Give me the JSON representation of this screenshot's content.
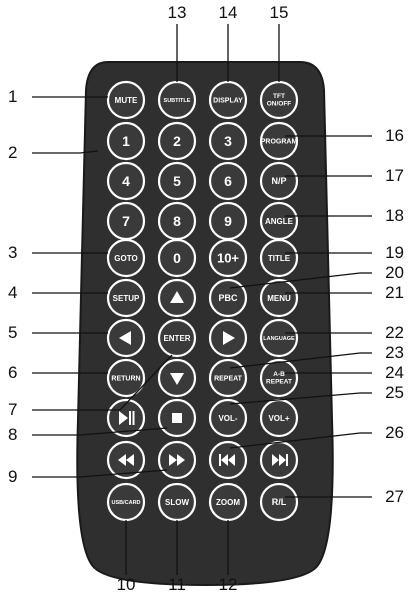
{
  "buttons": [
    {
      "id": "mute",
      "label": "MUTE"
    },
    {
      "id": "subtitle",
      "label": "SUBTITLE"
    },
    {
      "id": "display",
      "label": "DISPLAY"
    },
    {
      "id": "tft",
      "label": "TFT ON/OFF"
    },
    {
      "id": "num-1",
      "label": "1"
    },
    {
      "id": "num-2",
      "label": "2"
    },
    {
      "id": "num-3",
      "label": "3"
    },
    {
      "id": "program",
      "label": "PROGRAM"
    },
    {
      "id": "num-4",
      "label": "4"
    },
    {
      "id": "num-5",
      "label": "5"
    },
    {
      "id": "num-6",
      "label": "6"
    },
    {
      "id": "np",
      "label": "N/P"
    },
    {
      "id": "num-7",
      "label": "7"
    },
    {
      "id": "num-8",
      "label": "8"
    },
    {
      "id": "num-9",
      "label": "9"
    },
    {
      "id": "angle",
      "label": "ANGLE"
    },
    {
      "id": "goto",
      "label": "GOTO"
    },
    {
      "id": "num-0",
      "label": "0"
    },
    {
      "id": "num-10plus",
      "label": "10+"
    },
    {
      "id": "title",
      "label": "TITLE"
    },
    {
      "id": "setup",
      "label": "SETUP"
    },
    {
      "id": "up",
      "label": "",
      "icon": "up-arrow-icon"
    },
    {
      "id": "pbc",
      "label": "PBC"
    },
    {
      "id": "menu",
      "label": "MENU"
    },
    {
      "id": "left",
      "label": "",
      "icon": "left-arrow-icon"
    },
    {
      "id": "enter",
      "label": "ENTER"
    },
    {
      "id": "right",
      "label": "",
      "icon": "right-arrow-icon"
    },
    {
      "id": "language",
      "label": "LANGUAGE"
    },
    {
      "id": "return",
      "label": "RETURN"
    },
    {
      "id": "down",
      "label": "",
      "icon": "down-arrow-icon"
    },
    {
      "id": "repeat",
      "label": "REPEAT"
    },
    {
      "id": "ab-repeat",
      "label": "A-B REPEAT"
    },
    {
      "id": "play-pause",
      "label": "",
      "icon": "play-pause-icon"
    },
    {
      "id": "stop",
      "label": "",
      "icon": "stop-icon"
    },
    {
      "id": "vol-down",
      "label": "VOL-"
    },
    {
      "id": "vol-up",
      "label": "VOL+"
    },
    {
      "id": "rewind",
      "label": "",
      "icon": "rewind-icon"
    },
    {
      "id": "fast-forward",
      "label": "",
      "icon": "fast-forward-icon"
    },
    {
      "id": "prev",
      "label": "",
      "icon": "previous-track-icon"
    },
    {
      "id": "next",
      "label": "",
      "icon": "next-track-icon"
    },
    {
      "id": "usb-card",
      "label": "USB/CARD"
    },
    {
      "id": "slow",
      "label": "SLOW"
    },
    {
      "id": "zoom",
      "label": "ZOOM"
    },
    {
      "id": "rl",
      "label": "R/L"
    }
  ],
  "callouts": [
    {
      "number": "1",
      "target": "mute"
    },
    {
      "number": "2",
      "target": "num-1"
    },
    {
      "number": "3",
      "target": "goto"
    },
    {
      "number": "4",
      "target": "setup"
    },
    {
      "number": "5",
      "target": "left"
    },
    {
      "number": "6",
      "target": "return"
    },
    {
      "number": "7",
      "target": "enter"
    },
    {
      "number": "8",
      "target": "stop"
    },
    {
      "number": "9",
      "target": "fast-forward"
    },
    {
      "number": "10",
      "target": "usb-card"
    },
    {
      "number": "11",
      "target": "slow"
    },
    {
      "number": "12",
      "target": "zoom"
    },
    {
      "number": "13",
      "target": "subtitle"
    },
    {
      "number": "14",
      "target": "display"
    },
    {
      "number": "15",
      "target": "tft"
    },
    {
      "number": "16",
      "target": "program"
    },
    {
      "number": "17",
      "target": "np"
    },
    {
      "number": "18",
      "target": "angle"
    },
    {
      "number": "19",
      "target": "title"
    },
    {
      "number": "20",
      "target": "pbc"
    },
    {
      "number": "21",
      "target": "menu"
    },
    {
      "number": "22",
      "target": "language"
    },
    {
      "number": "23",
      "target": "repeat"
    },
    {
      "number": "24",
      "target": "ab-repeat"
    },
    {
      "number": "25",
      "target": "vol-up"
    },
    {
      "number": "26",
      "target": "next"
    },
    {
      "number": "27",
      "target": "rl"
    }
  ],
  "colors": {
    "body": "#2f2f2f",
    "body_edge": "#1a1a1a",
    "button": "#3a3a3a",
    "button_ring": "#ffffff",
    "label": "#ffffff",
    "leader_line": "#111111"
  }
}
